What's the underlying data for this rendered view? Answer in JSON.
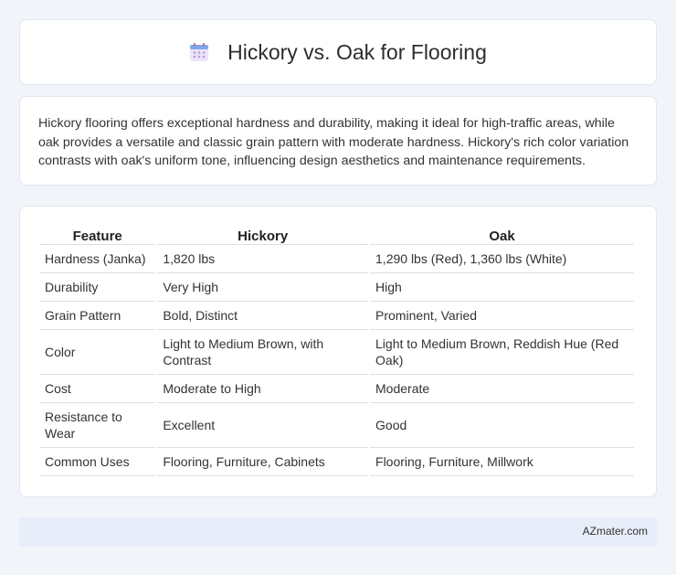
{
  "header": {
    "icon": "calendar-icon",
    "title": "Hickory vs. Oak for Flooring"
  },
  "summary": {
    "text": "Hickory flooring offers exceptional hardness and durability, making it ideal for high-traffic areas, while oak provides a versatile and classic grain pattern with moderate hardness. Hickory's rich color variation contrasts with oak's uniform tone, influencing design aesthetics and maintenance requirements."
  },
  "table": {
    "headers": [
      "Feature",
      "Hickory",
      "Oak"
    ],
    "rows": [
      [
        "Hardness (Janka)",
        "1,820 lbs",
        "1,290 lbs (Red), 1,360 lbs (White)"
      ],
      [
        "Durability",
        "Very High",
        "High"
      ],
      [
        "Grain Pattern",
        "Bold, Distinct",
        "Prominent, Varied"
      ],
      [
        "Color",
        "Light to Medium Brown, with Contrast",
        "Light to Medium Brown, Reddish Hue (Red Oak)"
      ],
      [
        "Cost",
        "Moderate to High",
        "Moderate"
      ],
      [
        "Resistance to Wear",
        "Excellent",
        "Good"
      ],
      [
        "Common Uses",
        "Flooring, Furniture, Cabinets",
        "Flooring, Furniture, Millwork"
      ]
    ]
  },
  "footer": {
    "text": "AZmater.com"
  }
}
